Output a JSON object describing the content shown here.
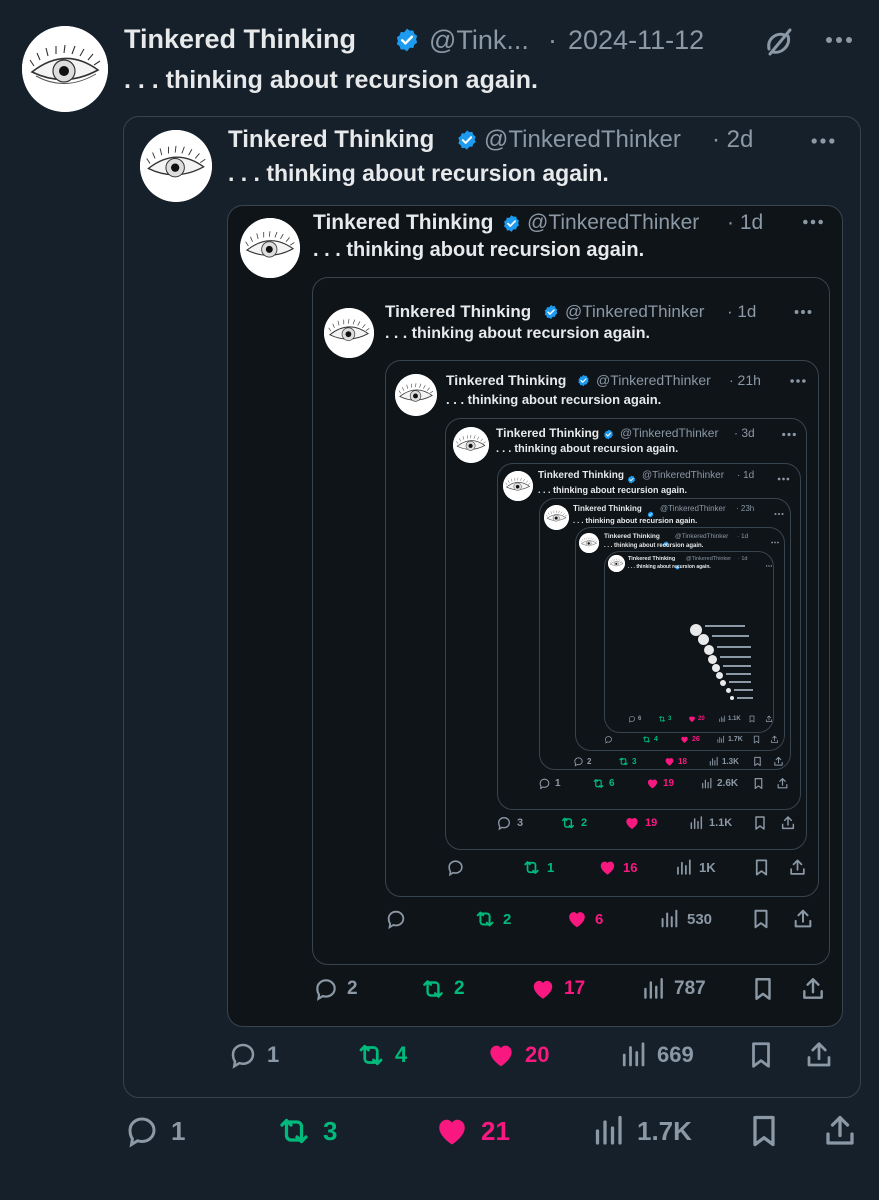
{
  "tweet": {
    "author_name": "Tinkered Thinking",
    "handle": "@Tink...",
    "separator": "·",
    "date": "2024-11-12",
    "text": ". . . thinking about recursion again.",
    "actions": {
      "replies": "1",
      "retweets": "3",
      "likes": "21",
      "views": "1.7K"
    }
  },
  "quotes": [
    {
      "name": "Tinkered Thinking",
      "handle": "@TinkeredThinker",
      "time": "· 2d",
      "text": ". . . thinking about recursion again.",
      "actions": {
        "replies": "1",
        "retweets": "4",
        "likes": "20",
        "views": "669"
      }
    },
    {
      "name": "Tinkered Thinking",
      "handle": "@TinkeredThinker",
      "time": "· 1d",
      "text": ". . . thinking about recursion again.",
      "actions": {
        "replies": "2",
        "retweets": "2",
        "likes": "17",
        "views": "787"
      }
    },
    {
      "name": "Tinkered Thinking",
      "handle": "@TinkeredThinker",
      "time": "· 1d",
      "text": ". . . thinking about recursion again.",
      "actions": {
        "replies": "",
        "retweets": "2",
        "likes": "6",
        "views": "530"
      }
    },
    {
      "name": "Tinkered Thinking",
      "handle": "@TinkeredThinker",
      "time": "· 21h",
      "text": ". . . thinking about recursion again.",
      "actions": {
        "replies": "",
        "retweets": "1",
        "likes": "16",
        "views": "1K"
      }
    },
    {
      "name": "Tinkered Thinking",
      "handle": "@TinkeredThinker",
      "time": "· 3d",
      "text": ". . . thinking about recursion again.",
      "actions": {
        "replies": "3",
        "retweets": "2",
        "likes": "19",
        "views": "1.1K"
      }
    },
    {
      "name": "Tinkered Thinking",
      "handle": "@TinkeredThinker",
      "time": "· 1d",
      "text": ". . . thinking about recursion again.",
      "actions": {
        "replies": "1",
        "retweets": "6",
        "likes": "19",
        "views": "2.6K"
      }
    },
    {
      "name": "Tinkered Thinking",
      "handle": "@TinkeredThinker",
      "time": "· 23h",
      "text": ". . . thinking about recursion again.",
      "actions": {
        "replies": "2",
        "retweets": "3",
        "likes": "18",
        "views": "1.3K"
      }
    },
    {
      "name": "Tinkered Thinking",
      "handle": "@TinkeredThinker",
      "time": "· 1d",
      "text": ". . . thinking about recursion again.",
      "actions": {
        "replies": "",
        "retweets": "4",
        "likes": "26",
        "views": "1.7K"
      }
    },
    {
      "name": "Tinkered Thinking",
      "handle": "@TinkeredThinker",
      "time": "· 1d",
      "text": ". . . thinking about recursion again.",
      "actions": {
        "replies": "6",
        "retweets": "3",
        "likes": "20",
        "views": "1.1K"
      }
    }
  ],
  "colors": {
    "background": "#15202b",
    "verified": "#1d9bf0",
    "retweet": "#00ba7c",
    "like": "#f91880",
    "muted": "#8b98a5"
  },
  "icons": [
    "verified-badge-icon",
    "grok-icon",
    "more-icon",
    "reply-icon",
    "retweet-icon",
    "heart-icon",
    "views-icon",
    "bookmark-icon",
    "share-icon"
  ]
}
